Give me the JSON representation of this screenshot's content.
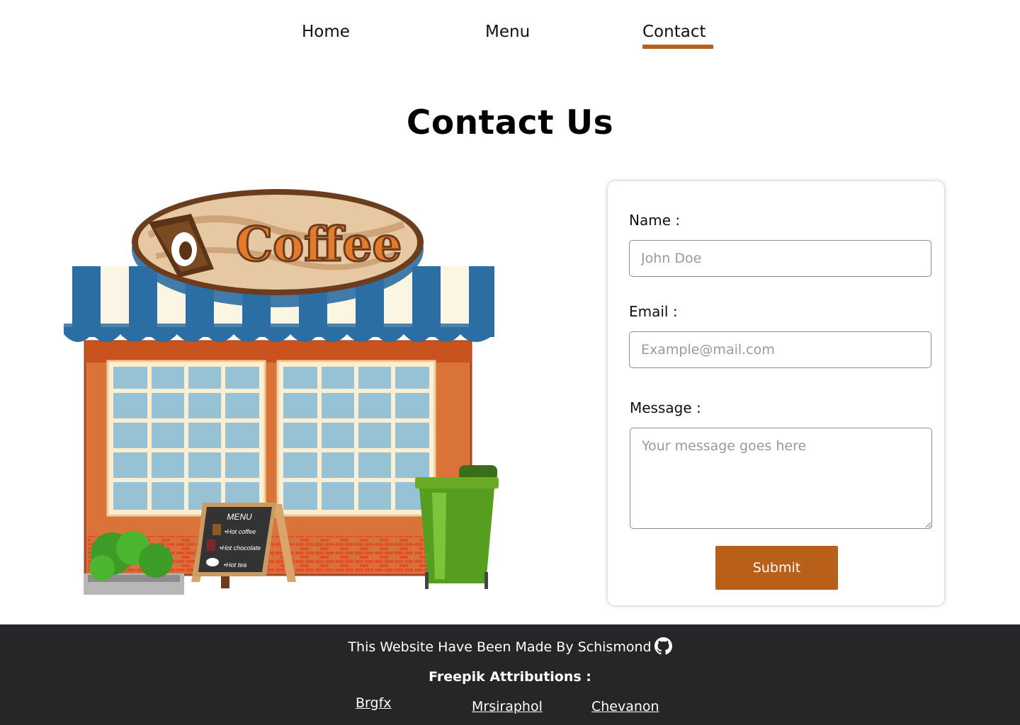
{
  "nav": {
    "items": [
      {
        "label": "Home"
      },
      {
        "label": "Menu"
      },
      {
        "label": "Contact",
        "active": true
      }
    ],
    "accent_color": "#b85f1a"
  },
  "page": {
    "title": "Contact Us"
  },
  "illustration": {
    "sign_text": "Coffee",
    "menu_board": {
      "title": "MENU",
      "items": [
        "•Hot coffee",
        "•Hot chocolate",
        "•Hot tea"
      ]
    }
  },
  "form": {
    "name": {
      "label": "Name :",
      "placeholder": "John Doe"
    },
    "email": {
      "label": "Email :",
      "placeholder": "Example@mail.com"
    },
    "message": {
      "label": "Message :",
      "placeholder": "Your message goes here"
    },
    "submit_label": "Submit",
    "button_color": "#b85f1a"
  },
  "footer": {
    "credit": "This Website Have Been Made By Schismond",
    "credit_icon": "github-icon",
    "attributions_title": "Freepik Attributions :",
    "links": [
      "Brgfx",
      "Mrsiraphol",
      "Chevanon"
    ],
    "background": "#262629"
  }
}
